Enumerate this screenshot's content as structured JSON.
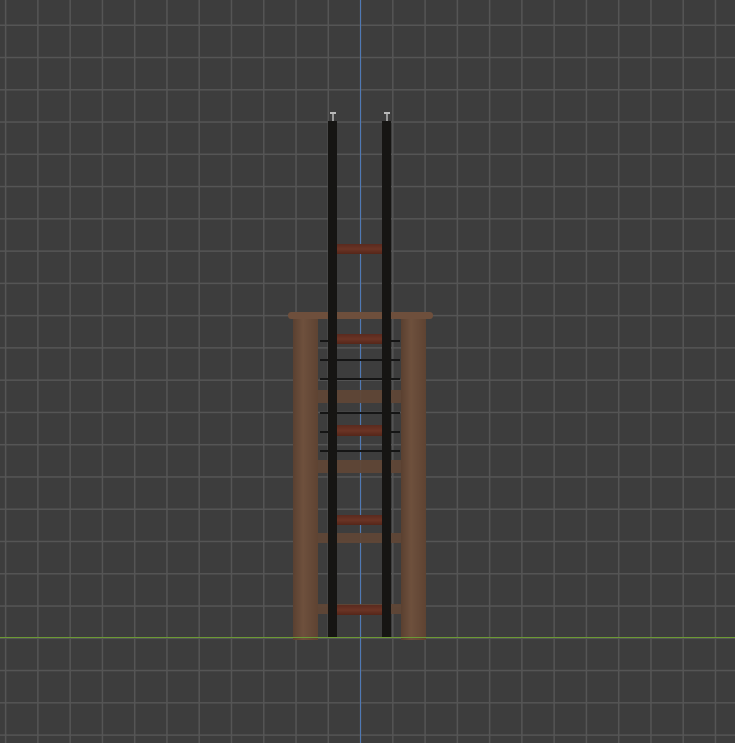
{
  "viewport": {
    "view": "3d-viewport-front-orthographic",
    "colors": {
      "background": "#3d3d3d",
      "grid": "#555555",
      "axis_z": "#4f79b5",
      "axis_x": "#6c9a34",
      "wood": "#6e503d",
      "rung": "#6b3425",
      "rail": "#161513"
    }
  }
}
